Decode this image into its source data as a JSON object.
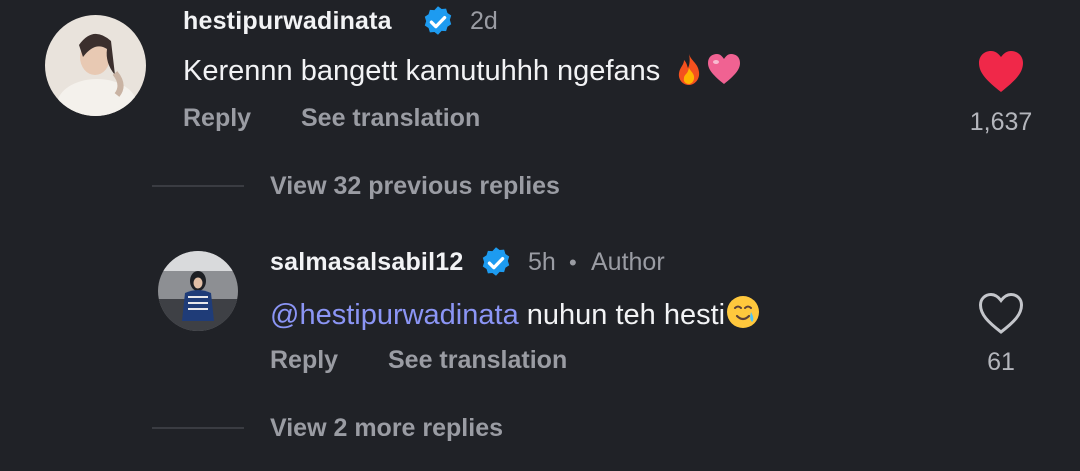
{
  "comment": {
    "username": "hestipurwadinata",
    "time": "2d",
    "text": "Kerennn bangett kamutuhhh ngefans",
    "emoji_icons": [
      "fire-icon",
      "pink-heart-icon"
    ],
    "reply_label": "Reply",
    "translate_label": "See translation",
    "like_count": "1,637",
    "liked": true,
    "like_color": "#f02849"
  },
  "previous_replies_label": "View 32 previous replies",
  "reply": {
    "username": "salmasalsabil12",
    "time": "5h",
    "separator": "•",
    "author_label": "Author",
    "mention": "@hestipurwadinata",
    "text": " nuhun teh hesti",
    "emoji_icon": "crying-smile-icon",
    "reply_label": "Reply",
    "translate_label": "See translation",
    "like_count": "61",
    "liked": false
  },
  "more_replies_label": "View 2 more replies",
  "colors": {
    "background": "#202227",
    "verified_badge": "#1d9bf0",
    "mention": "#8b95f5",
    "muted_text": "#9a9ca3"
  }
}
